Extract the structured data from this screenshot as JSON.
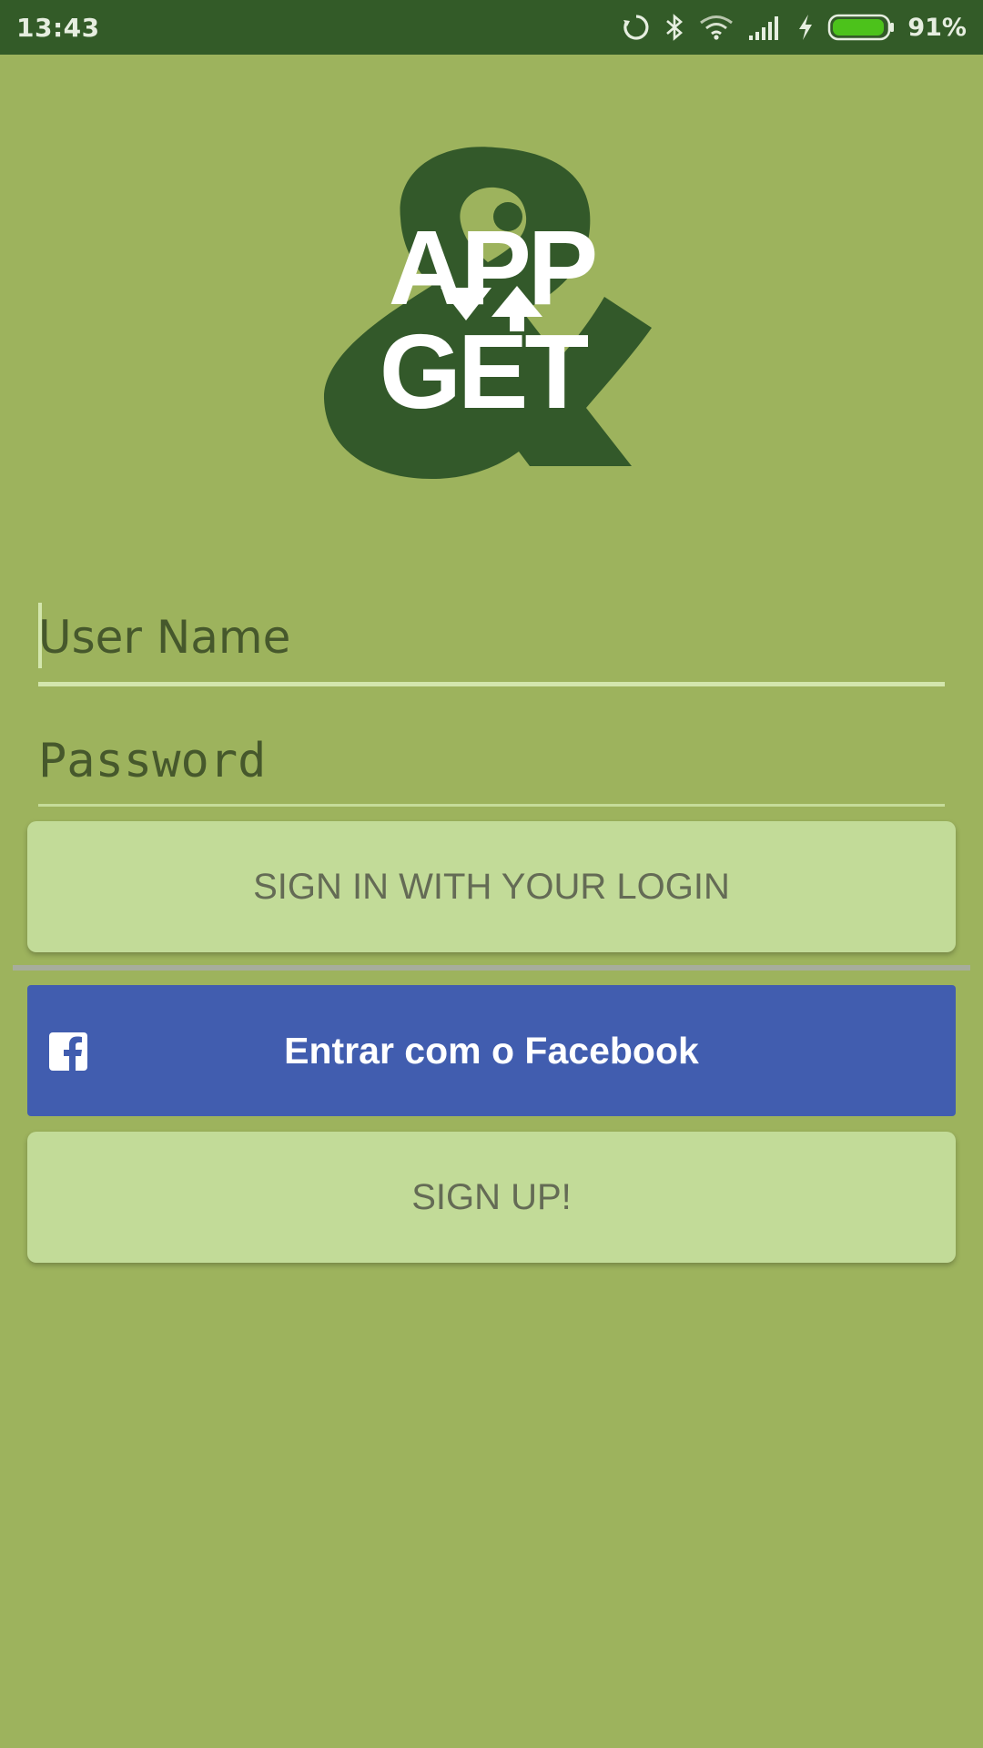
{
  "status_bar": {
    "time": "13:43",
    "battery_percent": "91%",
    "icons": [
      "sync-icon",
      "bluetooth-icon",
      "wifi-icon",
      "signal-icon",
      "charging-icon",
      "battery-icon"
    ]
  },
  "logo": {
    "name": "app-get-logo",
    "line1": "APP",
    "line2": "GET"
  },
  "form": {
    "username_placeholder": "User Name",
    "password_placeholder": "Password"
  },
  "buttons": {
    "login_label": "SIGN IN WITH YOUR LOGIN",
    "facebook_label": "Entrar com o Facebook",
    "signup_label": "SIGN UP!"
  },
  "colors": {
    "background": "#9db35d",
    "status_bar": "#335b28",
    "button_light": "#c2db98",
    "facebook": "#415daf",
    "logo_dark": "#33592a"
  }
}
